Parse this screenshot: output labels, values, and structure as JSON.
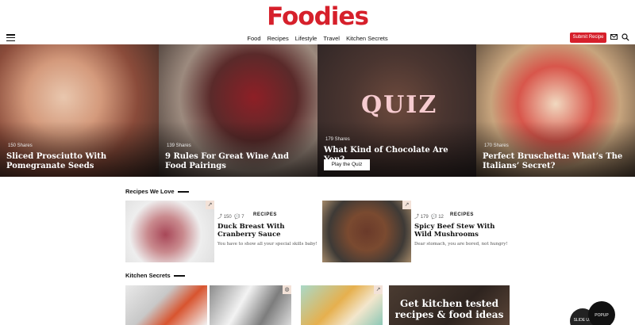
{
  "site": {
    "logo": "Foodies"
  },
  "nav": {
    "items": [
      "Food",
      "Recipes",
      "Lifestyle",
      "Travel",
      "Kitchen Secrets"
    ],
    "submit_label": "Submit Recipe"
  },
  "hero": [
    {
      "shares": "150 Shares",
      "title": "Sliced Prosciutto With Pomegranate Seeds"
    },
    {
      "shares": "139 Shares",
      "title": "9 Rules For Great Wine And Food Pairings"
    },
    {
      "shares": "179 Shares",
      "title": "What Kind of Chocolate Are You?",
      "overlay": "QUIZ",
      "button": "Play the Quiz"
    },
    {
      "shares": "170 Shares",
      "title": "Perfect Bruschetta: What’s The Italians’ Secret?"
    }
  ],
  "recipes": {
    "heading": "Recipes We Love",
    "items": [
      {
        "shares": "150",
        "comments": "7",
        "tag": "RECIPES",
        "title": "Duck Breast With Cranberry Sauce",
        "desc": "You have to show all your special skills baby!"
      },
      {
        "shares": "179",
        "comments": "12",
        "tag": "RECIPES",
        "title": "Spicy Beef Stew With Wild Mushrooms",
        "desc": "Dear stomach, you are bored, not hungry!"
      }
    ]
  },
  "kitchen": {
    "heading": "Kitchen Secrets",
    "promo": "Get kitchen tested recipes & food ideas"
  },
  "floating": {
    "slide_up": "SLIDE UP",
    "popup": "POPUP"
  },
  "colors": {
    "brand": "#d6202b"
  }
}
